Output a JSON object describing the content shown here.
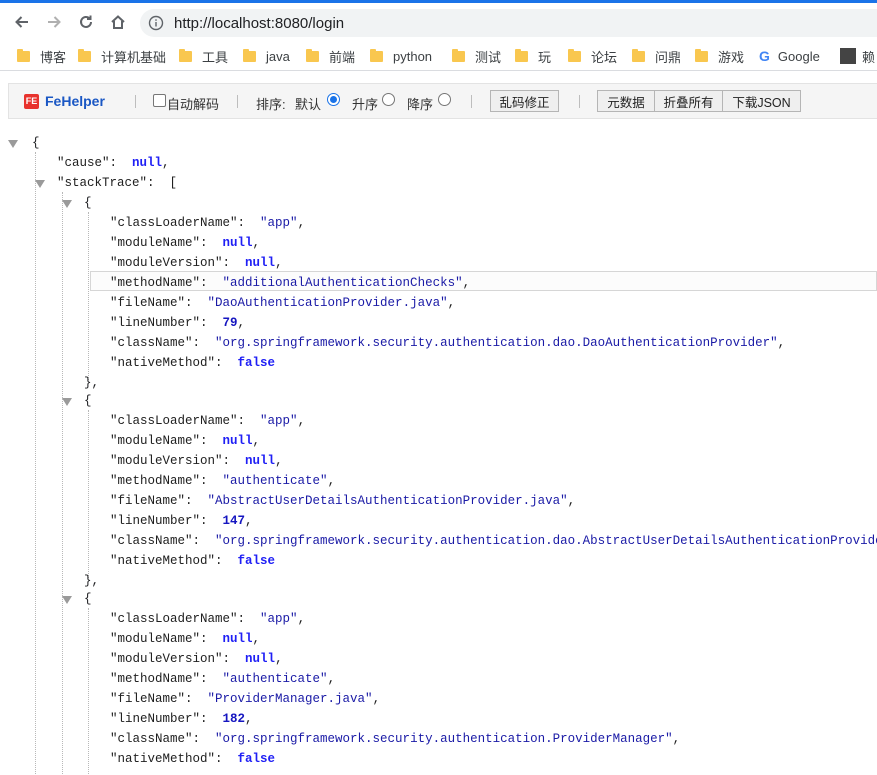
{
  "browser": {
    "url": "http://localhost:8080/login",
    "bookmarks": [
      {
        "label": "博客",
        "icon": "folder-icon"
      },
      {
        "label": "计算机基础",
        "icon": "folder-icon"
      },
      {
        "label": "工具",
        "icon": "folder-icon"
      },
      {
        "label": "java",
        "icon": "folder-icon"
      },
      {
        "label": "前端",
        "icon": "folder-icon"
      },
      {
        "label": "python",
        "icon": "folder-icon"
      },
      {
        "label": "测试",
        "icon": "folder-icon"
      },
      {
        "label": "玩",
        "icon": "folder-icon"
      },
      {
        "label": "论坛",
        "icon": "folder-icon"
      },
      {
        "label": "问鼎",
        "icon": "folder-icon"
      },
      {
        "label": "游戏",
        "icon": "folder-icon"
      },
      {
        "label": "Google",
        "icon": "google-icon"
      },
      {
        "label": "赖",
        "icon": "avatar-icon"
      }
    ]
  },
  "fehelper": {
    "logo_badge": "FE",
    "name": "FeHelper",
    "auto_decode_label": "自动解码",
    "sort_label": "排序:",
    "sort_default": "默认",
    "sort_asc": "升序",
    "sort_desc": "降序",
    "fix_encoding": "乱码修正",
    "metadata": "元数据",
    "collapse_all": "折叠所有",
    "download_json": "下载JSON"
  },
  "json": {
    "open_brace": "{",
    "cause_key": "\"cause\"",
    "cause_value": "null",
    "stacktrace_key": "\"stackTrace\"",
    "open_bracket": "[",
    "frames": [
      {
        "classLoaderName": "\"app\"",
        "moduleName": "null",
        "moduleVersion": "null",
        "methodName": "\"additionalAuthenticationChecks\"",
        "fileName": "\"DaoAuthenticationProvider.java\"",
        "lineNumber": "79",
        "className": "\"org.springframework.security.authentication.dao.DaoAuthenticationProvider\"",
        "nativeMethod": "false"
      },
      {
        "classLoaderName": "\"app\"",
        "moduleName": "null",
        "moduleVersion": "null",
        "methodName": "\"authenticate\"",
        "fileName": "\"AbstractUserDetailsAuthenticationProvider.java\"",
        "lineNumber": "147",
        "className": "\"org.springframework.security.authentication.dao.AbstractUserDetailsAuthenticationProvider\"",
        "nativeMethod": "false"
      },
      {
        "classLoaderName": "\"app\"",
        "moduleName": "null",
        "moduleVersion": "null",
        "methodName": "\"authenticate\"",
        "fileName": "\"ProviderManager.java\"",
        "lineNumber": "182",
        "className": "\"org.springframework.security.authentication.ProviderManager\"",
        "nativeMethod": "false"
      }
    ]
  }
}
